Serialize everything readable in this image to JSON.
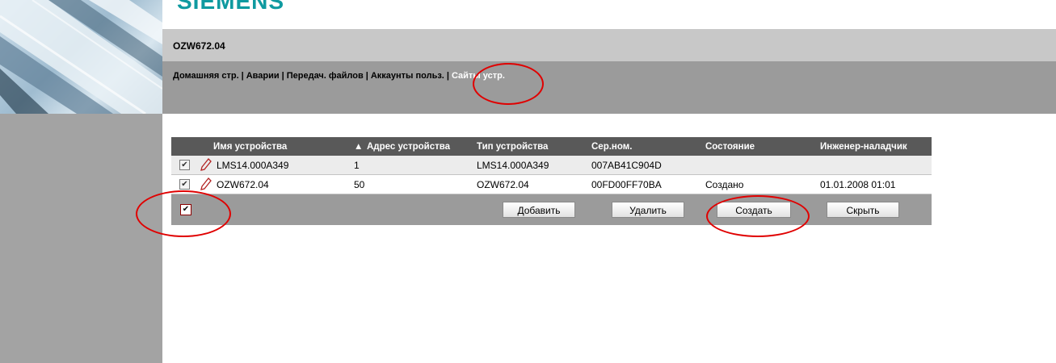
{
  "brand": {
    "logo": "SIEMENS"
  },
  "device": {
    "title": "OZW672.04"
  },
  "nav": {
    "items": [
      "Домашняя стр.",
      "Аварии",
      "Передач. файлов",
      "Аккаунты польз.",
      "Сайты устр."
    ],
    "separator": "|",
    "active_index": 4
  },
  "table": {
    "columns": [
      "Имя устройства",
      "Адрес устройства",
      "Тип устройства",
      "Сер.ном.",
      "Состояние",
      "Инженер-наладчик"
    ],
    "sort_indicator": "▲",
    "rows": [
      {
        "checked": true,
        "name": "LMS14.000A349",
        "address": "1",
        "type": "LMS14.000A349",
        "serial": "007AB41C904D",
        "state": "",
        "engineer": ""
      },
      {
        "checked": true,
        "name": "OZW672.04",
        "address": "50",
        "type": "OZW672.04",
        "serial": "00FD00FF70BA",
        "state": "Создано",
        "engineer": "01.01.2008 01:01"
      }
    ]
  },
  "actions": {
    "select_all_checked": true,
    "add": "Добавить",
    "delete": "Удалить",
    "create": "Создать",
    "hide": "Скрыть"
  },
  "colors": {
    "annotation": "#e00000",
    "logo": "#0f9aa0",
    "header_bg": "#595959",
    "nav_bg": "#9b9b9b"
  },
  "icons": {
    "row_edit": "pencil-icon",
    "checkbox": "checkmark-icon"
  }
}
